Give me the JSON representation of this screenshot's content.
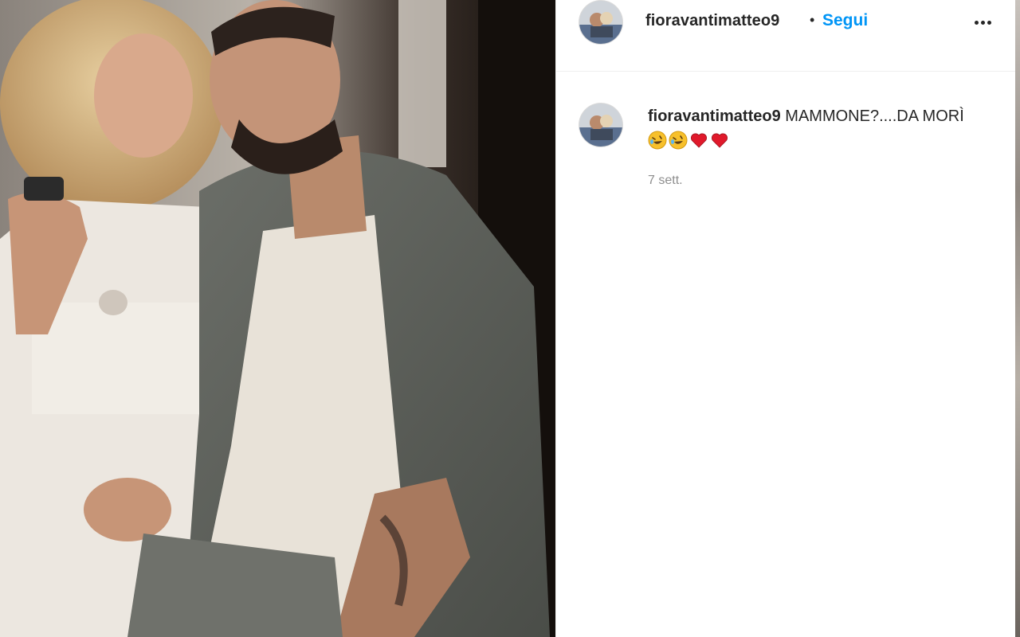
{
  "post": {
    "author": "fioravantimatteo9",
    "follow_separator": "•",
    "follow_label": "Segui",
    "more_icon": "more-horizontal-icon",
    "photo_alt": "Foto"
  },
  "caption": {
    "username": "fioravantimatteo9",
    "text": "MAMMONE?....DA MORÌ",
    "emojis": [
      "rolling-on-floor-laughing-icon",
      "rolling-on-floor-laughing-icon",
      "red-heart-icon",
      "red-heart-icon"
    ],
    "timestamp": "7 sett."
  },
  "colors": {
    "follow": "#0095f6",
    "text": "#262626",
    "muted": "#8e8e8e",
    "heart": "#e0192b",
    "emoji_face": "#f7c02b"
  }
}
